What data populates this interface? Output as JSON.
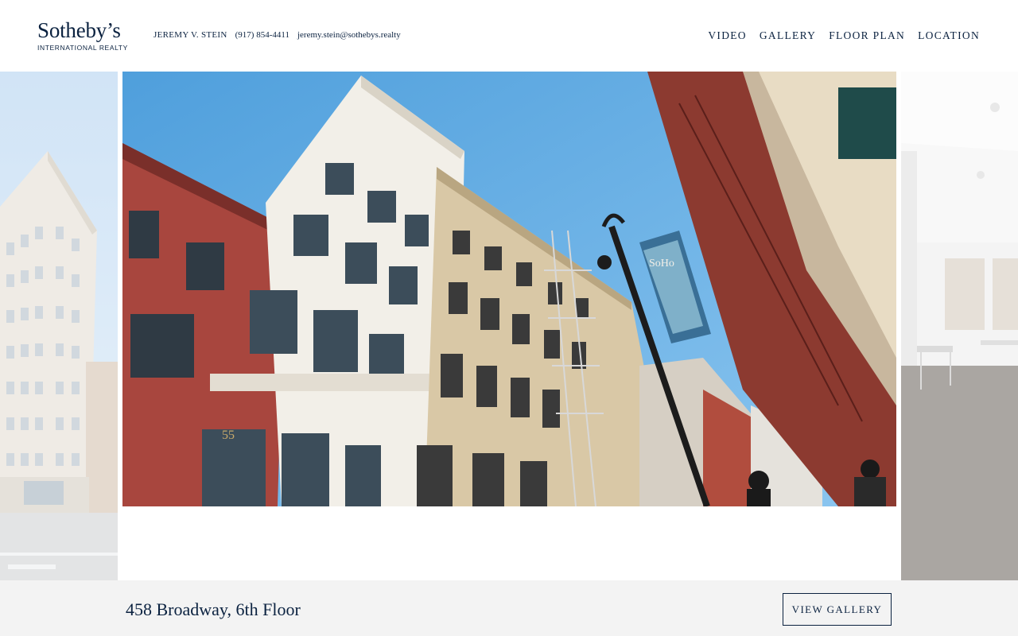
{
  "header": {
    "logo": {
      "name": "Sotheby’s",
      "subtitle": "INTERNATIONAL REALTY"
    },
    "agent": {
      "name": "JEREMY V. STEIN",
      "phone": "(917) 854-4411",
      "email": "jeremy.stein@sothebys.realty"
    },
    "nav": [
      {
        "label": "VIDEO"
      },
      {
        "label": "GALLERY"
      },
      {
        "label": "FLOOR PLAN"
      },
      {
        "label": "LOCATION"
      }
    ]
  },
  "gallery": {
    "banner_text": "SoHo",
    "building_number": "55"
  },
  "listing": {
    "address": "458 Broadway, 6th Floor",
    "view_gallery_label": "VIEW GALLERY"
  },
  "colors": {
    "brand_navy": "#0b2240",
    "bottom_bar": "#f3f3f3",
    "sky": "#5aa6e0"
  }
}
